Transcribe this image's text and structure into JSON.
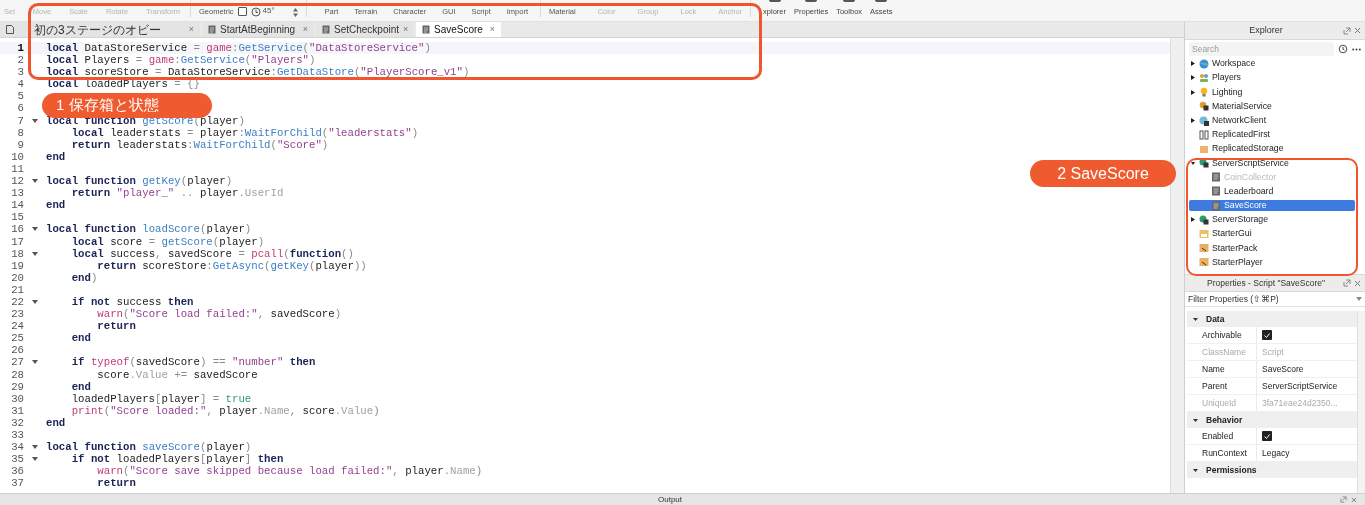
{
  "toolbar": {
    "groups": [
      {
        "items": [
          {
            "kind": "button",
            "label": "Sel",
            "disabled": true
          },
          {
            "kind": "button",
            "label": "Move",
            "disabled": true
          },
          {
            "kind": "button",
            "label": "Scale",
            "disabled": true
          },
          {
            "kind": "button",
            "label": "Rotate",
            "disabled": true
          },
          {
            "kind": "button",
            "label": "Transform",
            "disabled": true
          }
        ]
      },
      {
        "items": [
          {
            "kind": "button",
            "label": "Geometric",
            "disabled": false
          },
          {
            "kind": "checkbox",
            "checked": false
          },
          {
            "kind": "angle",
            "value": "45°"
          }
        ]
      },
      {
        "items": [
          {
            "kind": "button",
            "label": "Part",
            "disabled": false
          },
          {
            "kind": "button",
            "label": "Terrain",
            "disabled": false
          },
          {
            "kind": "button",
            "label": "Character",
            "disabled": false
          },
          {
            "kind": "button",
            "label": "GUI",
            "disabled": false
          },
          {
            "kind": "button",
            "label": "Script",
            "disabled": false
          },
          {
            "kind": "button",
            "label": "Import",
            "disabled": false
          }
        ]
      },
      {
        "items": [
          {
            "kind": "button",
            "label": "Material",
            "disabled": false
          },
          {
            "kind": "button",
            "label": "Color",
            "disabled": true
          },
          {
            "kind": "button",
            "label": "Group",
            "disabled": true
          },
          {
            "kind": "button",
            "label": "Lock",
            "disabled": true
          },
          {
            "kind": "button",
            "label": "Anchor",
            "disabled": true
          }
        ]
      },
      {
        "items": [
          {
            "kind": "view",
            "label": "xplorer",
            "disabled": false
          },
          {
            "kind": "view",
            "label": "Properties",
            "disabled": false
          },
          {
            "kind": "view",
            "label": "Toolbox",
            "disabled": false
          },
          {
            "kind": "view",
            "label": "Assets",
            "disabled": false
          }
        ]
      }
    ]
  },
  "tabs": [
    {
      "label": "初の3ステージのオビー",
      "kind": "place",
      "selected": false
    },
    {
      "label": "StartAtBeginning",
      "kind": "script",
      "selected": false
    },
    {
      "label": "SetCheckpoint",
      "kind": "script",
      "selected": false
    },
    {
      "label": "SaveScore",
      "kind": "script",
      "selected": true
    }
  ],
  "close_label": "×",
  "code": [
    {
      "n": "1",
      "fold": false,
      "current": true,
      "tokens": [
        {
          "kind": "keyword",
          "text": "local"
        },
        {
          "kind": "name",
          "text": " DataStoreService"
        },
        {
          "kind": "op",
          "text": " = "
        },
        {
          "kind": "builtin",
          "text": "game"
        },
        {
          "kind": "op",
          "text": ":"
        },
        {
          "kind": "method",
          "text": "GetService"
        },
        {
          "kind": "op",
          "text": "("
        },
        {
          "kind": "string",
          "text": "\"DataStoreService\""
        },
        {
          "kind": "op",
          "text": ")"
        }
      ]
    },
    {
      "n": "2",
      "fold": false,
      "current": false,
      "tokens": [
        {
          "kind": "keyword",
          "text": "local"
        },
        {
          "kind": "name",
          "text": " Players"
        },
        {
          "kind": "op",
          "text": " = "
        },
        {
          "kind": "builtin",
          "text": "game"
        },
        {
          "kind": "op",
          "text": ":"
        },
        {
          "kind": "method",
          "text": "GetService"
        },
        {
          "kind": "op",
          "text": "("
        },
        {
          "kind": "string",
          "text": "\"Players\""
        },
        {
          "kind": "op",
          "text": ")"
        }
      ]
    },
    {
      "n": "3",
      "fold": false,
      "current": false,
      "tokens": [
        {
          "kind": "keyword",
          "text": "local"
        },
        {
          "kind": "name",
          "text": " scoreStore"
        },
        {
          "kind": "op",
          "text": " = "
        },
        {
          "kind": "name",
          "text": "DataStoreService"
        },
        {
          "kind": "op",
          "text": ":"
        },
        {
          "kind": "method",
          "text": "GetDataStore"
        },
        {
          "kind": "op",
          "text": "("
        },
        {
          "kind": "string",
          "text": "\"PlayerScore_v1\""
        },
        {
          "kind": "op",
          "text": ")"
        }
      ]
    },
    {
      "n": "4",
      "fold": false,
      "current": false,
      "tokens": [
        {
          "kind": "keyword",
          "text": "local"
        },
        {
          "kind": "name",
          "text": " loadedPlayers"
        },
        {
          "kind": "op",
          "text": " = {}"
        }
      ]
    },
    {
      "n": "5",
      "fold": false,
      "current": false
    },
    {
      "n": "6",
      "fold": false,
      "current": false
    },
    {
      "n": "7",
      "fold": true,
      "current": false,
      "tokens": [
        {
          "kind": "keyword",
          "text": "local"
        },
        {
          "kind": "keyword",
          "text": " function"
        },
        {
          "kind": "method",
          "text": " getScore"
        },
        {
          "kind": "op",
          "text": "("
        },
        {
          "kind": "name",
          "text": "player"
        },
        {
          "kind": "op",
          "text": ")"
        }
      ]
    },
    {
      "n": "8",
      "fold": false,
      "current": false,
      "tokens": [
        {
          "kind": "keyword",
          "text": "    local"
        },
        {
          "kind": "name",
          "text": " leaderstats"
        },
        {
          "kind": "op",
          "text": " = "
        },
        {
          "kind": "name",
          "text": "player"
        },
        {
          "kind": "op",
          "text": ":"
        },
        {
          "kind": "method",
          "text": "WaitForChild"
        },
        {
          "kind": "op",
          "text": "("
        },
        {
          "kind": "string",
          "text": "\"leaderstats\""
        },
        {
          "kind": "op",
          "text": ")"
        }
      ]
    },
    {
      "n": "9",
      "fold": false,
      "current": false,
      "tokens": [
        {
          "kind": "keyword",
          "text": "    return"
        },
        {
          "kind": "name",
          "text": " leaderstats"
        },
        {
          "kind": "op",
          "text": ":"
        },
        {
          "kind": "method",
          "text": "WaitForChild"
        },
        {
          "kind": "op",
          "text": "("
        },
        {
          "kind": "string",
          "text": "\"Score\""
        },
        {
          "kind": "op",
          "text": ")"
        }
      ]
    },
    {
      "n": "10",
      "fold": false,
      "current": false,
      "tokens": [
        {
          "kind": "keyword",
          "text": "end"
        }
      ]
    },
    {
      "n": "11",
      "fold": false,
      "current": false
    },
    {
      "n": "12",
      "fold": true,
      "current": false,
      "tokens": [
        {
          "kind": "keyword",
          "text": "local"
        },
        {
          "kind": "keyword",
          "text": " function"
        },
        {
          "kind": "method",
          "text": " getKey"
        },
        {
          "kind": "op",
          "text": "("
        },
        {
          "kind": "name",
          "text": "player"
        },
        {
          "kind": "op",
          "text": ")"
        }
      ]
    },
    {
      "n": "13",
      "fold": false,
      "current": false,
      "tokens": [
        {
          "kind": "keyword",
          "text": "    return"
        },
        {
          "kind": "string",
          "text": " \"player_\""
        },
        {
          "kind": "op",
          "text": " .. "
        },
        {
          "kind": "name",
          "text": "player"
        },
        {
          "kind": "field",
          "text": ".UserId"
        }
      ]
    },
    {
      "n": "14",
      "fold": false,
      "current": false,
      "tokens": [
        {
          "kind": "keyword",
          "text": "end"
        }
      ]
    },
    {
      "n": "15",
      "fold": false,
      "current": false
    },
    {
      "n": "16",
      "fold": true,
      "current": false,
      "tokens": [
        {
          "kind": "keyword",
          "text": "local"
        },
        {
          "kind": "keyword",
          "text": " function"
        },
        {
          "kind": "method",
          "text": " loadScore"
        },
        {
          "kind": "op",
          "text": "("
        },
        {
          "kind": "name",
          "text": "player"
        },
        {
          "kind": "op",
          "text": ")"
        }
      ]
    },
    {
      "n": "17",
      "fold": false,
      "current": false,
      "tokens": [
        {
          "kind": "keyword",
          "text": "    local"
        },
        {
          "kind": "name",
          "text": " score"
        },
        {
          "kind": "op",
          "text": " = "
        },
        {
          "kind": "method",
          "text": "getScore"
        },
        {
          "kind": "op",
          "text": "("
        },
        {
          "kind": "name",
          "text": "player"
        },
        {
          "kind": "op",
          "text": ")"
        }
      ]
    },
    {
      "n": "18",
      "fold": true,
      "current": false,
      "tokens": [
        {
          "kind": "keyword",
          "text": "    local"
        },
        {
          "kind": "name",
          "text": " success"
        },
        {
          "kind": "op",
          "text": ","
        },
        {
          "kind": "name",
          "text": " savedScore"
        },
        {
          "kind": "op",
          "text": " = "
        },
        {
          "kind": "builtin",
          "text": "pcall"
        },
        {
          "kind": "op",
          "text": "("
        },
        {
          "kind": "keyword",
          "text": "function"
        },
        {
          "kind": "op",
          "text": "()"
        }
      ]
    },
    {
      "n": "19",
      "fold": false,
      "current": false,
      "tokens": [
        {
          "kind": "keyword",
          "text": "        return"
        },
        {
          "kind": "name",
          "text": " scoreStore"
        },
        {
          "kind": "op",
          "text": ":"
        },
        {
          "kind": "method",
          "text": "GetAsync"
        },
        {
          "kind": "op",
          "text": "("
        },
        {
          "kind": "method",
          "text": "getKey"
        },
        {
          "kind": "op",
          "text": "("
        },
        {
          "kind": "name",
          "text": "player"
        },
        {
          "kind": "op",
          "text": "))"
        }
      ]
    },
    {
      "n": "20",
      "fold": false,
      "current": false,
      "tokens": [
        {
          "kind": "keyword",
          "text": "    end"
        },
        {
          "kind": "op",
          "text": ")"
        }
      ]
    },
    {
      "n": "21",
      "fold": false,
      "current": false
    },
    {
      "n": "22",
      "fold": true,
      "current": false,
      "tokens": [
        {
          "kind": "keyword",
          "text": "    if not"
        },
        {
          "kind": "name",
          "text": " success"
        },
        {
          "kind": "keyword",
          "text": " then"
        }
      ]
    },
    {
      "n": "23",
      "fold": false,
      "current": false,
      "tokens": [
        {
          "kind": "builtin",
          "text": "        warn"
        },
        {
          "kind": "op",
          "text": "("
        },
        {
          "kind": "string",
          "text": "\"Score load failed:\""
        },
        {
          "kind": "op",
          "text": ","
        },
        {
          "kind": "name",
          "text": " savedScore"
        },
        {
          "kind": "op",
          "text": ")"
        }
      ]
    },
    {
      "n": "24",
      "fold": false,
      "current": false,
      "tokens": [
        {
          "kind": "keyword",
          "text": "        return"
        }
      ]
    },
    {
      "n": "25",
      "fold": false,
      "current": false,
      "tokens": [
        {
          "kind": "keyword",
          "text": "    end"
        }
      ]
    },
    {
      "n": "26",
      "fold": false,
      "current": false
    },
    {
      "n": "27",
      "fold": true,
      "current": false,
      "tokens": [
        {
          "kind": "keyword",
          "text": "    if"
        },
        {
          "kind": "builtin",
          "text": " typeof"
        },
        {
          "kind": "op",
          "text": "("
        },
        {
          "kind": "name",
          "text": "savedScore"
        },
        {
          "kind": "op",
          "text": ") == "
        },
        {
          "kind": "string",
          "text": "\"number\""
        },
        {
          "kind": "keyword",
          "text": " then"
        }
      ]
    },
    {
      "n": "28",
      "fold": false,
      "current": false,
      "tokens": [
        {
          "kind": "name",
          "text": "        score"
        },
        {
          "kind": "field",
          "text": ".Value"
        },
        {
          "kind": "op",
          "text": " += "
        },
        {
          "kind": "name",
          "text": "savedScore"
        }
      ]
    },
    {
      "n": "29",
      "fold": false,
      "current": false,
      "tokens": [
        {
          "kind": "keyword",
          "text": "    end"
        }
      ]
    },
    {
      "n": "30",
      "fold": false,
      "current": false,
      "tokens": [
        {
          "kind": "name",
          "text": "    loadedPlayers"
        },
        {
          "kind": "op",
          "text": "["
        },
        {
          "kind": "name",
          "text": "player"
        },
        {
          "kind": "op",
          "text": "] = "
        },
        {
          "kind": "literal",
          "text": "true"
        }
      ]
    },
    {
      "n": "31",
      "fold": false,
      "current": false,
      "tokens": [
        {
          "kind": "builtin",
          "text": "    print"
        },
        {
          "kind": "op",
          "text": "("
        },
        {
          "kind": "string",
          "text": "\"Score loaded:\""
        },
        {
          "kind": "op",
          "text": ","
        },
        {
          "kind": "name",
          "text": " player"
        },
        {
          "kind": "field",
          "text": ".Name"
        },
        {
          "kind": "op",
          "text": ","
        },
        {
          "kind": "name",
          "text": " score"
        },
        {
          "kind": "field",
          "text": ".Value"
        },
        {
          "kind": "op",
          "text": ")"
        }
      ]
    },
    {
      "n": "32",
      "fold": false,
      "current": false,
      "tokens": [
        {
          "kind": "keyword",
          "text": "end"
        }
      ]
    },
    {
      "n": "33",
      "fold": false,
      "current": false
    },
    {
      "n": "34",
      "fold": true,
      "current": false,
      "tokens": [
        {
          "kind": "keyword",
          "text": "local"
        },
        {
          "kind": "keyword",
          "text": " function"
        },
        {
          "kind": "method",
          "text": " saveScore"
        },
        {
          "kind": "op",
          "text": "("
        },
        {
          "kind": "name",
          "text": "player"
        },
        {
          "kind": "op",
          "text": ")"
        }
      ]
    },
    {
      "n": "35",
      "fold": true,
      "current": false,
      "tokens": [
        {
          "kind": "keyword",
          "text": "    if not"
        },
        {
          "kind": "name",
          "text": " loadedPlayers"
        },
        {
          "kind": "op",
          "text": "["
        },
        {
          "kind": "name",
          "text": "player"
        },
        {
          "kind": "op",
          "text": "]"
        },
        {
          "kind": "keyword",
          "text": " then"
        }
      ]
    },
    {
      "n": "36",
      "fold": false,
      "current": false,
      "tokens": [
        {
          "kind": "builtin",
          "text": "        warn"
        },
        {
          "kind": "op",
          "text": "("
        },
        {
          "kind": "string",
          "text": "\"Score save skipped because load failed:\""
        },
        {
          "kind": "op",
          "text": ","
        },
        {
          "kind": "name",
          "text": " player"
        },
        {
          "kind": "field",
          "text": ".Name"
        },
        {
          "kind": "op",
          "text": ")"
        }
      ]
    },
    {
      "n": "37",
      "fold": false,
      "current": false,
      "tokens": [
        {
          "kind": "keyword",
          "text": "        return"
        }
      ]
    }
  ],
  "explorer": {
    "title": "Explorer",
    "search": {
      "placeholder": "Search"
    },
    "items": [
      {
        "label": "Workspace",
        "kind": "globe",
        "expanded": false,
        "selected": false,
        "disabled": false
      },
      {
        "label": "Players",
        "kind": "people",
        "expanded": false,
        "selected": false,
        "disabled": false
      },
      {
        "label": "Lighting",
        "kind": "bulb",
        "expanded": false,
        "selected": false,
        "disabled": false
      },
      {
        "label": "MaterialService",
        "kind": "service",
        "selected": false,
        "disabled": false
      },
      {
        "label": "NetworkClient",
        "kind": "network",
        "expanded": false,
        "selected": false,
        "disabled": false
      },
      {
        "label": "ReplicatedFirst",
        "kind": "replicated",
        "selected": false,
        "disabled": false
      },
      {
        "label": "ReplicatedStorage",
        "kind": "box",
        "selected": false,
        "disabled": false
      },
      {
        "label": "ServerScriptService",
        "kind": "server",
        "expanded": true,
        "selected": false,
        "disabled": false,
        "children": [
          {
            "label": "CoinCollector",
            "kind": "script",
            "selected": false,
            "disabled": true
          },
          {
            "label": "Leaderboard",
            "kind": "script",
            "selected": false,
            "disabled": false
          },
          {
            "label": "SaveScore",
            "kind": "script",
            "selected": true,
            "disabled": false
          }
        ]
      },
      {
        "label": "ServerStorage",
        "kind": "server",
        "expanded": false,
        "selected": false,
        "disabled": false
      },
      {
        "label": "StarterGui",
        "kind": "gui",
        "selected": false,
        "disabled": false
      },
      {
        "label": "StarterPack",
        "kind": "pack",
        "selected": false,
        "disabled": false
      },
      {
        "label": "StarterPlayer",
        "kind": "pack",
        "selected": false,
        "disabled": false
      }
    ]
  },
  "properties": {
    "title": "Properties - Script \"SaveScore\"",
    "filter": {
      "placeholder": "Filter Properties (⇧⌘P)"
    },
    "sections": [
      {
        "title": "Data",
        "expanded": true,
        "rows": [
          {
            "name": "Archivable",
            "kind": "checkbox",
            "checked": true,
            "disabled": false
          },
          {
            "name": "ClassName",
            "kind": "text",
            "value": "Script",
            "disabled": true
          },
          {
            "name": "Name",
            "kind": "text",
            "value": "SaveScore",
            "disabled": false
          },
          {
            "name": "Parent",
            "kind": "text",
            "value": "ServerScriptService",
            "disabled": false
          },
          {
            "name": "UniqueId",
            "kind": "text",
            "value": "3fa71eae24d2350...",
            "disabled": true
          }
        ]
      },
      {
        "title": "Behavior",
        "expanded": true,
        "rows": [
          {
            "name": "Enabled",
            "kind": "checkbox",
            "checked": true,
            "disabled": false
          },
          {
            "name": "RunContext",
            "kind": "text",
            "value": "Legacy",
            "disabled": false
          }
        ]
      },
      {
        "title": "Permissions",
        "expanded": true
      }
    ]
  },
  "output": {
    "title": "Output"
  },
  "annotations": [
    {
      "label": "1 保存箱と状態"
    },
    {
      "label": "2 SaveScore"
    }
  ]
}
